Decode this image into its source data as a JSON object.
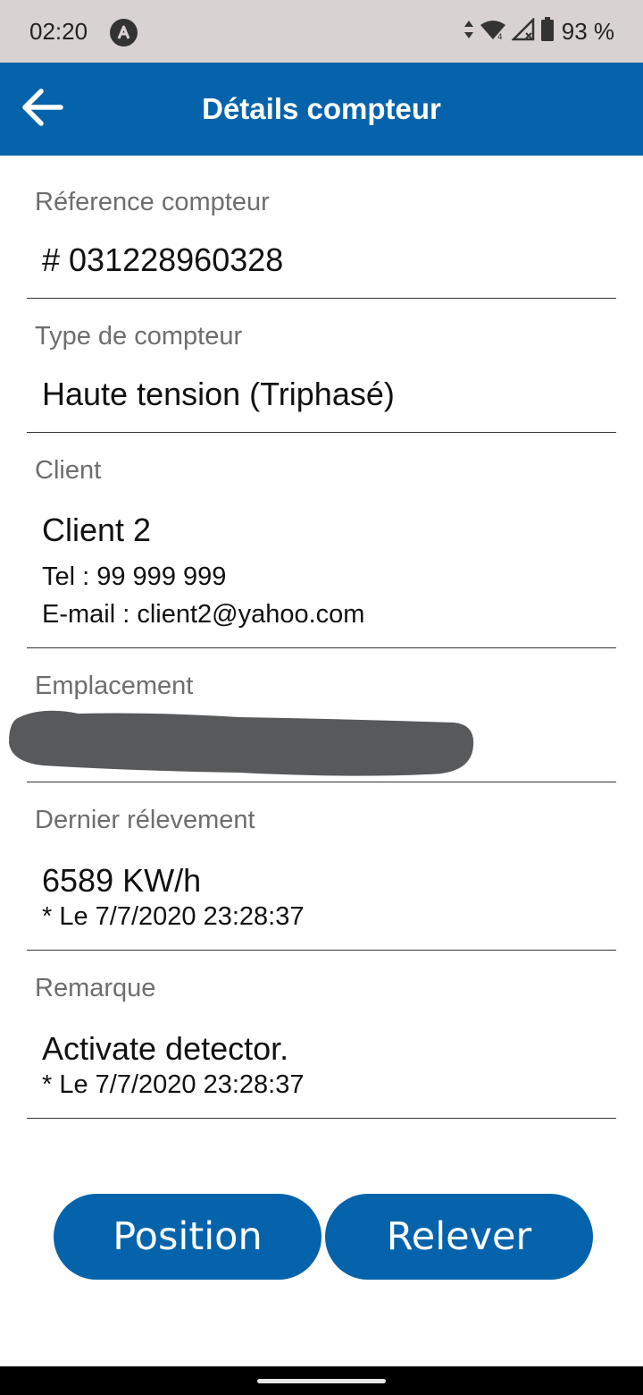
{
  "status_bar": {
    "time": "02:20",
    "battery_text": "93 %",
    "icons": [
      "app-notification-icon",
      "data-arrows-icon",
      "wifi-icon",
      "cell-signal-icon",
      "battery-icon"
    ]
  },
  "app_bar": {
    "title": "Détails compteur",
    "back_icon": "arrow-left-icon",
    "color": "#0563ab"
  },
  "fields": {
    "reference": {
      "label": "Réference compteur",
      "value": "# 031228960328"
    },
    "type": {
      "label": "Type de compteur",
      "value": "Haute tension (Triphasé)"
    },
    "client": {
      "label": "Client",
      "name": "Client 2",
      "tel": "Tel : 99 999 999",
      "email": "E-mail : client2@yahoo.com"
    },
    "emplacement": {
      "label": "Emplacement"
    },
    "releve": {
      "label": "Dernier rélevement",
      "value": "6589 KW/h",
      "date": "* Le 7/7/2020 23:28:37"
    },
    "remarque": {
      "label": "Remarque",
      "value": "Activate detector.",
      "date": "* Le 7/7/2020 23:28:37"
    }
  },
  "buttons": {
    "position": "Position",
    "relever": "Relever"
  }
}
